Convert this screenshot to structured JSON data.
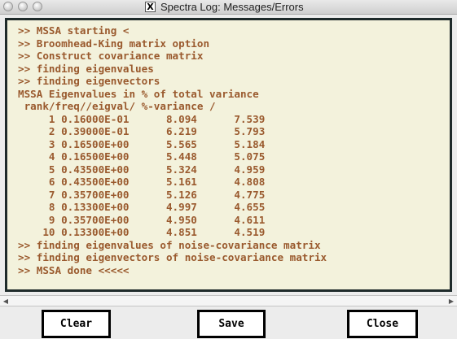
{
  "window": {
    "title": "Spectra Log: Messages/Errors"
  },
  "log": {
    "lines": [
      ">> MSSA starting <",
      ">> Broomhead-King matrix option",
      ">> Construct covariance matrix",
      ">> finding eigenvalues",
      ">> finding eigenvectors",
      "MSSA Eigenvalues in % of total variance",
      " rank/freq//eigval/ %-variance /",
      "     1 0.16000E-01      8.094      7.539",
      "     2 0.39000E-01      6.219      5.793",
      "     3 0.16500E+00      5.565      5.184",
      "     4 0.16500E+00      5.448      5.075",
      "     5 0.43500E+00      5.324      4.959",
      "     6 0.43500E+00      5.161      4.808",
      "     7 0.35700E+00      5.126      4.775",
      "     8 0.13300E+00      4.997      4.655",
      "     9 0.35700E+00      4.950      4.611",
      "    10 0.13300E+00      4.851      4.519",
      ">> finding eigenvalues of noise-covariance matrix",
      ">> finding eigenvectors of noise-covariance matrix",
      ">> MSSA done <<<<<"
    ]
  },
  "buttons": {
    "clear": "Clear",
    "save": "Save",
    "close": "Close"
  },
  "icons": {
    "app": "X",
    "scroll_left": "◀",
    "scroll_right": "▶"
  }
}
